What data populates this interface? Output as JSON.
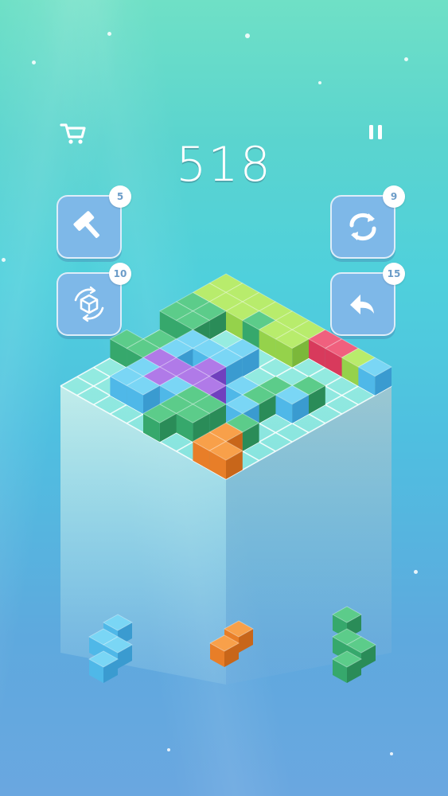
{
  "score": "518",
  "powerups": {
    "hammer": {
      "count": "5"
    },
    "shuffle": {
      "count": "9"
    },
    "rotate": {
      "count": "10"
    },
    "undo": {
      "count": "15"
    }
  },
  "colors": {
    "board_line": "#ffffff",
    "green": "#3fb97a",
    "lime": "#a6e05a",
    "blue": "#5ec8ef",
    "purple": "#9a63e0",
    "red": "#e9456a",
    "orange": "#f08a2e"
  },
  "board": {
    "size": 10,
    "cells": [
      {
        "i": 0,
        "j": 0,
        "c": "lime"
      },
      {
        "i": 1,
        "j": 0,
        "c": "lime"
      },
      {
        "i": 0,
        "j": 1,
        "c": "lime"
      },
      {
        "i": 1,
        "j": 1,
        "c": "lime"
      },
      {
        "i": 2,
        "j": 0,
        "c": "green"
      },
      {
        "i": 3,
        "j": 0,
        "c": "green"
      },
      {
        "i": 2,
        "j": 1,
        "c": "green"
      },
      {
        "i": 3,
        "j": 1,
        "c": "green"
      },
      {
        "i": 0,
        "j": 2,
        "c": "lime"
      },
      {
        "i": 0,
        "j": 3,
        "c": "lime"
      },
      {
        "i": 1,
        "j": 2,
        "c": "lime"
      },
      {
        "i": 0,
        "j": 4,
        "c": "lime"
      },
      {
        "i": 1,
        "j": 3,
        "c": "green"
      },
      {
        "i": 0,
        "j": 5,
        "c": "lime"
      },
      {
        "i": 1,
        "j": 4,
        "c": "lime"
      },
      {
        "i": 1,
        "j": 5,
        "c": "lime"
      },
      {
        "i": 0,
        "j": 6,
        "c": "red"
      },
      {
        "i": 0,
        "j": 7,
        "c": "red"
      },
      {
        "i": 0,
        "j": 8,
        "c": "lime"
      },
      {
        "i": 0,
        "j": 9,
        "c": "blue"
      },
      {
        "i": 5,
        "j": 1,
        "c": "green"
      },
      {
        "i": 6,
        "j": 1,
        "c": "green"
      },
      {
        "i": 6,
        "j": 0,
        "c": "green"
      },
      {
        "i": 4,
        "j": 2,
        "c": "blue"
      },
      {
        "i": 5,
        "j": 2,
        "c": "blue"
      },
      {
        "i": 4,
        "j": 3,
        "c": "blue"
      },
      {
        "i": 3,
        "j": 4,
        "c": "blue"
      },
      {
        "i": 4,
        "j": 4,
        "c": "blue"
      },
      {
        "i": 6,
        "j": 2,
        "c": "purple"
      },
      {
        "i": 6,
        "j": 3,
        "c": "purple"
      },
      {
        "i": 7,
        "j": 3,
        "c": "purple"
      },
      {
        "i": 5,
        "j": 4,
        "c": "purple"
      },
      {
        "i": 6,
        "j": 4,
        "c": "purple"
      },
      {
        "i": 6,
        "j": 5,
        "c": "purple"
      },
      {
        "i": 7,
        "j": 2,
        "c": "blue"
      },
      {
        "i": 8,
        "j": 2,
        "c": "blue"
      },
      {
        "i": 8,
        "j": 3,
        "c": "blue"
      },
      {
        "i": 7,
        "j": 4,
        "c": "blue"
      },
      {
        "i": 7,
        "j": 5,
        "c": "green"
      },
      {
        "i": 8,
        "j": 5,
        "c": "green"
      },
      {
        "i": 7,
        "j": 6,
        "c": "green"
      },
      {
        "i": 9,
        "j": 5,
        "c": "green"
      },
      {
        "i": 8,
        "j": 6,
        "c": "green"
      },
      {
        "i": 3,
        "j": 8,
        "c": "green"
      },
      {
        "i": 4,
        "j": 8,
        "c": "blue"
      },
      {
        "i": 4,
        "j": 7,
        "c": "green"
      },
      {
        "i": 5,
        "j": 7,
        "c": "green"
      },
      {
        "i": 5,
        "j": 6,
        "c": "blue"
      },
      {
        "i": 6,
        "j": 7,
        "c": "blue"
      },
      {
        "i": 7,
        "j": 8,
        "c": "green"
      },
      {
        "i": 8,
        "j": 8,
        "c": "orange"
      },
      {
        "i": 9,
        "j": 8,
        "c": "orange"
      },
      {
        "i": 9,
        "j": 9,
        "c": "orange"
      }
    ]
  },
  "tray": [
    {
      "id": "piece-left",
      "color": "blue",
      "cells": [
        [
          0,
          1
        ],
        [
          1,
          0
        ],
        [
          1,
          1
        ],
        [
          2,
          0
        ]
      ]
    },
    {
      "id": "piece-middle",
      "color": "orange",
      "cells": [
        [
          0,
          1
        ],
        [
          1,
          0
        ]
      ]
    },
    {
      "id": "piece-right",
      "color": "green",
      "cells": [
        [
          0,
          0
        ],
        [
          1,
          0
        ],
        [
          1,
          1
        ],
        [
          2,
          0
        ]
      ]
    }
  ]
}
